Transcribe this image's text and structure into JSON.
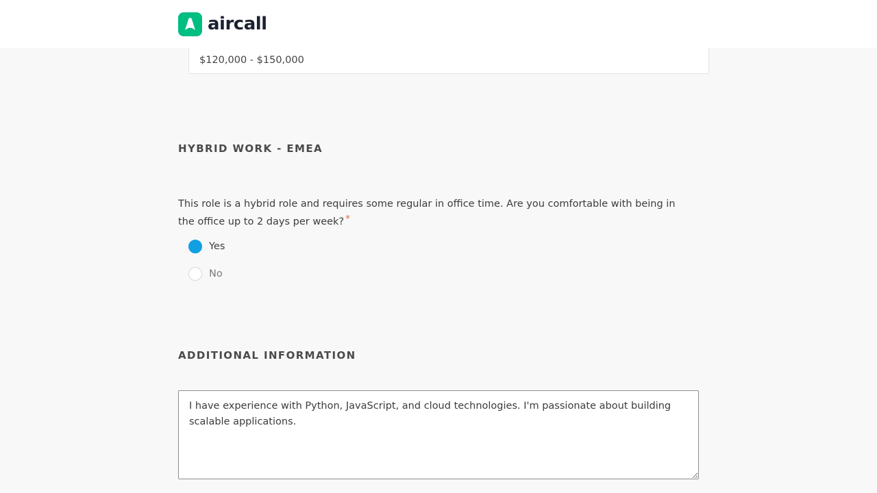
{
  "brand": {
    "name": "aircall",
    "color": "#00bd82",
    "logo_icon": "aircall-logo-icon"
  },
  "salary": {
    "value": "$120,000 - $150,000"
  },
  "hybrid_section": {
    "heading": "HYBRID WORK - EMEA",
    "question": "This role is a hybrid role and requires some regular in office time. Are you comfortable with being in the office up to 2 days per week?",
    "required_mark": "*",
    "options": [
      {
        "label": "Yes",
        "selected": true
      },
      {
        "label": "No",
        "selected": false
      }
    ],
    "accent_color": "#119fe3"
  },
  "additional_section": {
    "heading": "ADDITIONAL INFORMATION",
    "text": "I have experience with Python, JavaScript, and cloud technologies. I'm passionate about building scalable applications."
  }
}
